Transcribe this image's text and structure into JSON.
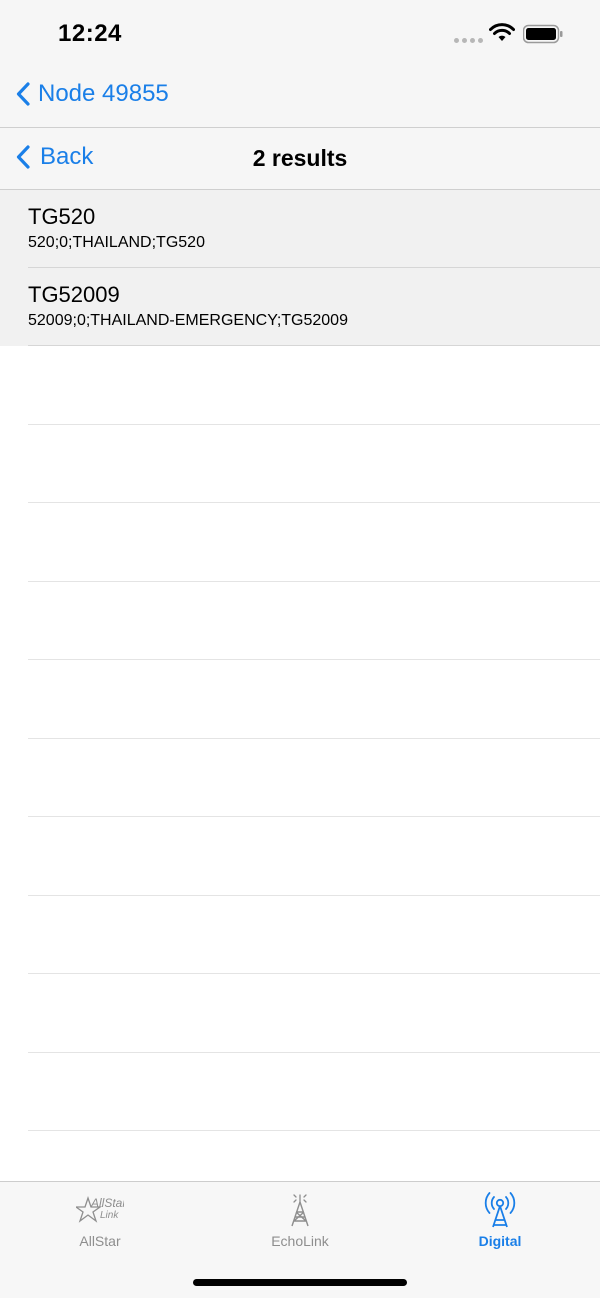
{
  "status_bar": {
    "time": "12:24"
  },
  "nav": {
    "parent_back_label": "Node 49855",
    "back_label": "Back",
    "title": "2 results"
  },
  "results": [
    {
      "title": "TG520",
      "subtitle": "520;0;THAILAND;TG520"
    },
    {
      "title": "TG52009",
      "subtitle": "52009;0;THAILAND-EMERGENCY;TG52009"
    }
  ],
  "tabs": [
    {
      "label": "AllStar",
      "icon": "allstar-link-logo-icon",
      "active": false
    },
    {
      "label": "EchoLink",
      "icon": "radio-tower-icon",
      "active": false
    },
    {
      "label": "Digital",
      "icon": "broadcast-antenna-icon",
      "active": true
    }
  ],
  "colors": {
    "accent": "#1a7fe8",
    "inactive": "#8e8e8e",
    "row_bg": "#f1f1f1"
  }
}
